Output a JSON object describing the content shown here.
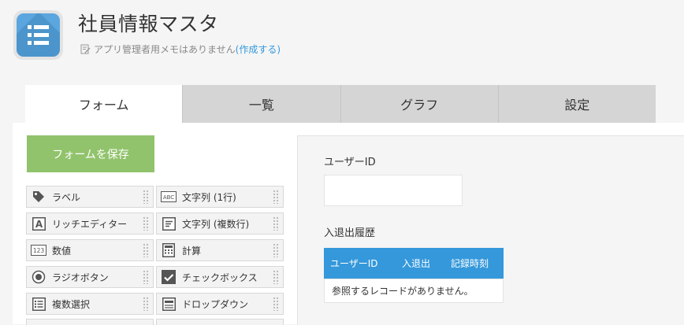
{
  "header": {
    "app_title": "社員情報マスタ",
    "memo_text": "アプリ管理者用メモはありません",
    "memo_link": "(作成する)",
    "app_icon": "list-icon"
  },
  "tabs": [
    {
      "label": "フォーム",
      "active": true
    },
    {
      "label": "一覧",
      "active": false
    },
    {
      "label": "グラフ",
      "active": false
    },
    {
      "label": "設定",
      "active": false
    }
  ],
  "palette": {
    "save_label": "フォームを保存",
    "items": [
      {
        "label": "ラベル",
        "icon": "tag-icon"
      },
      {
        "label": "文字列 (1行)",
        "icon": "abc-icon"
      },
      {
        "label": "リッチエディター",
        "icon": "rich-editor-icon"
      },
      {
        "label": "文字列 (複数行)",
        "icon": "multiline-text-icon"
      },
      {
        "label": "数値",
        "icon": "number-icon"
      },
      {
        "label": "計算",
        "icon": "calculator-icon"
      },
      {
        "label": "ラジオボタン",
        "icon": "radio-icon"
      },
      {
        "label": "チェックボックス",
        "icon": "checkbox-icon"
      },
      {
        "label": "複数選択",
        "icon": "multi-select-icon"
      },
      {
        "label": "ドロップダウン",
        "icon": "dropdown-icon"
      }
    ]
  },
  "form": {
    "field1_label": "ユーザーID",
    "field2_label": "入退出履歴",
    "table_columns": [
      "ユーザーID",
      "入退出",
      "記録時刻"
    ],
    "table_empty": "参照するレコードがありません。"
  },
  "colors": {
    "accent": "#3498db",
    "save_button": "#91c36c",
    "app_icon": "#5ba6de"
  }
}
